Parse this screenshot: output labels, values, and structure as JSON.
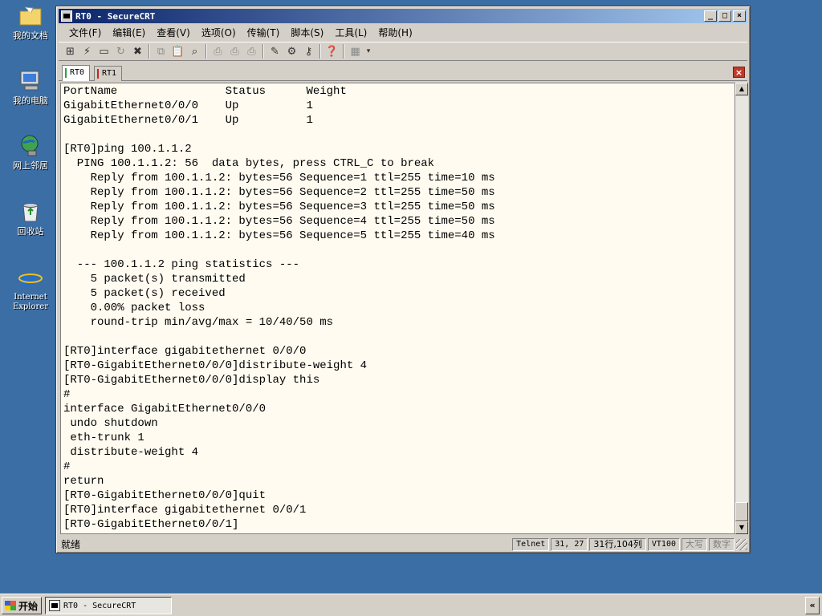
{
  "desktop": {
    "icons": [
      {
        "label": "我的文档",
        "icon": "folder-documents-icon"
      },
      {
        "label": "我的电脑",
        "icon": "computer-icon"
      },
      {
        "label": "网上邻居",
        "icon": "network-icon"
      },
      {
        "label": "回收站",
        "icon": "recycle-bin-icon"
      },
      {
        "label": "Internet\nExplorer",
        "icon": "internet-explorer-icon"
      }
    ]
  },
  "window": {
    "title": "RT0 - SecureCRT",
    "controls": {
      "minimize": "_",
      "maximize": "□",
      "close": "×"
    }
  },
  "menu": [
    "文件(F)",
    "编辑(E)",
    "查看(V)",
    "选项(O)",
    "传输(T)",
    "脚本(S)",
    "工具(L)",
    "帮助(H)"
  ],
  "toolbar": {
    "icons": [
      "connect-icon",
      "quick-connect-icon",
      "connect-tab-icon",
      "reconnect-icon",
      "disconnect-icon",
      "copy-icon",
      "paste-icon",
      "find-icon",
      "print-icon",
      "print-setup-icon",
      "print-selection-icon",
      "session-options-icon",
      "global-options-icon",
      "keymap-icon",
      "help-icon",
      "sftp-icon",
      "more-icon"
    ]
  },
  "tabs": [
    {
      "label": "RT0",
      "active": true,
      "mark_color": "#2e9e3e"
    },
    {
      "label": "RT1",
      "active": false,
      "mark_color": "#d02020"
    }
  ],
  "terminal": {
    "lines": [
      "PortName                Status      Weight",
      "GigabitEthernet0/0/0    Up          1",
      "GigabitEthernet0/0/1    Up          1",
      "",
      "[RT0]ping 100.1.1.2",
      "  PING 100.1.1.2: 56  data bytes, press CTRL_C to break",
      "    Reply from 100.1.1.2: bytes=56 Sequence=1 ttl=255 time=10 ms",
      "    Reply from 100.1.1.2: bytes=56 Sequence=2 ttl=255 time=50 ms",
      "    Reply from 100.1.1.2: bytes=56 Sequence=3 ttl=255 time=50 ms",
      "    Reply from 100.1.1.2: bytes=56 Sequence=4 ttl=255 time=50 ms",
      "    Reply from 100.1.1.2: bytes=56 Sequence=5 ttl=255 time=40 ms",
      "",
      "  --- 100.1.1.2 ping statistics ---",
      "    5 packet(s) transmitted",
      "    5 packet(s) received",
      "    0.00% packet loss",
      "    round-trip min/avg/max = 10/40/50 ms",
      "",
      "[RT0]interface gigabitethernet 0/0/0",
      "[RT0-GigabitEthernet0/0/0]distribute-weight 4",
      "[RT0-GigabitEthernet0/0/0]display this",
      "#",
      "interface GigabitEthernet0/0/0",
      " undo shutdown",
      " eth-trunk 1",
      " distribute-weight 4",
      "#",
      "return",
      "[RT0-GigabitEthernet0/0/0]quit",
      "[RT0]interface gigabitethernet 0/0/1",
      "[RT0-GigabitEthernet0/0/1]"
    ]
  },
  "status": {
    "ready": "就绪",
    "protocol": "Telnet",
    "cursor": "31,  27",
    "rowscols": "31行,104列",
    "emulation": "VT100",
    "caps": "大写",
    "num": "数字"
  },
  "taskbar": {
    "start": "开始",
    "task": "RT0 - SecureCRT",
    "tray": "«"
  },
  "colors": {
    "desktop": "#3a6ea5",
    "titlebar_start": "#0a246a",
    "titlebar_end": "#a6caf0",
    "terminal_bg": "#fffbf0"
  }
}
